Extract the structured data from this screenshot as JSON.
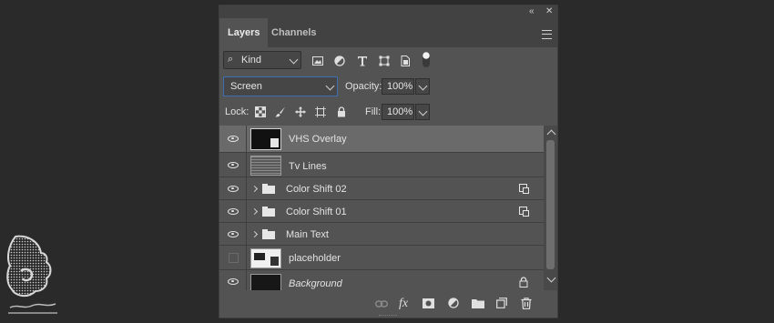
{
  "panel": {
    "top_controls": {
      "collapse": "«",
      "close": "✕"
    },
    "tabs": [
      {
        "label": "Layers",
        "active": true
      },
      {
        "label": "Channels",
        "active": false
      }
    ],
    "menu_icon": "hamburger-menu-icon"
  },
  "filter": {
    "kind_label": "Kind",
    "icons": [
      "image-filter-icon",
      "adjustment-filter-icon",
      "type-filter-icon",
      "shape-filter-icon",
      "smart-object-filter-icon",
      "filter-toggle-icon"
    ]
  },
  "blend": {
    "mode": "Screen",
    "opacity_label": "Opacity:",
    "opacity_value": "100%",
    "lock_label": "Lock:",
    "lock_icons": [
      "lock-transparent-icon",
      "lock-image-icon",
      "lock-position-icon",
      "lock-artboard-icon",
      "lock-all-icon"
    ],
    "fill_label": "Fill:",
    "fill_value": "100%"
  },
  "layers": [
    {
      "name": "VHS Overlay",
      "visible": true,
      "selected": true,
      "type": "smart-object"
    },
    {
      "name": "Tv Lines",
      "visible": true,
      "selected": false,
      "type": "pixel"
    },
    {
      "name": "Color Shift 02",
      "visible": true,
      "selected": false,
      "type": "group",
      "clipped": true
    },
    {
      "name": "Color Shift 01",
      "visible": true,
      "selected": false,
      "type": "group",
      "clipped": true
    },
    {
      "name": "Main Text",
      "visible": true,
      "selected": false,
      "type": "group"
    },
    {
      "name": "placeholder",
      "visible": false,
      "selected": false,
      "type": "smart-object"
    },
    {
      "name": "Background",
      "visible": true,
      "selected": false,
      "type": "background",
      "locked": true
    }
  ],
  "bottom_bar": {
    "icons": [
      "link-layers-icon",
      "fx-icon",
      "add-mask-icon",
      "new-adjustment-icon",
      "new-group-icon",
      "new-layer-icon",
      "delete-layer-icon"
    ],
    "fx_label": "fx"
  },
  "colors": {
    "panel_bg": "#535353",
    "selected_row": "#6a6a6a",
    "focus_border": "#3b6fae"
  }
}
